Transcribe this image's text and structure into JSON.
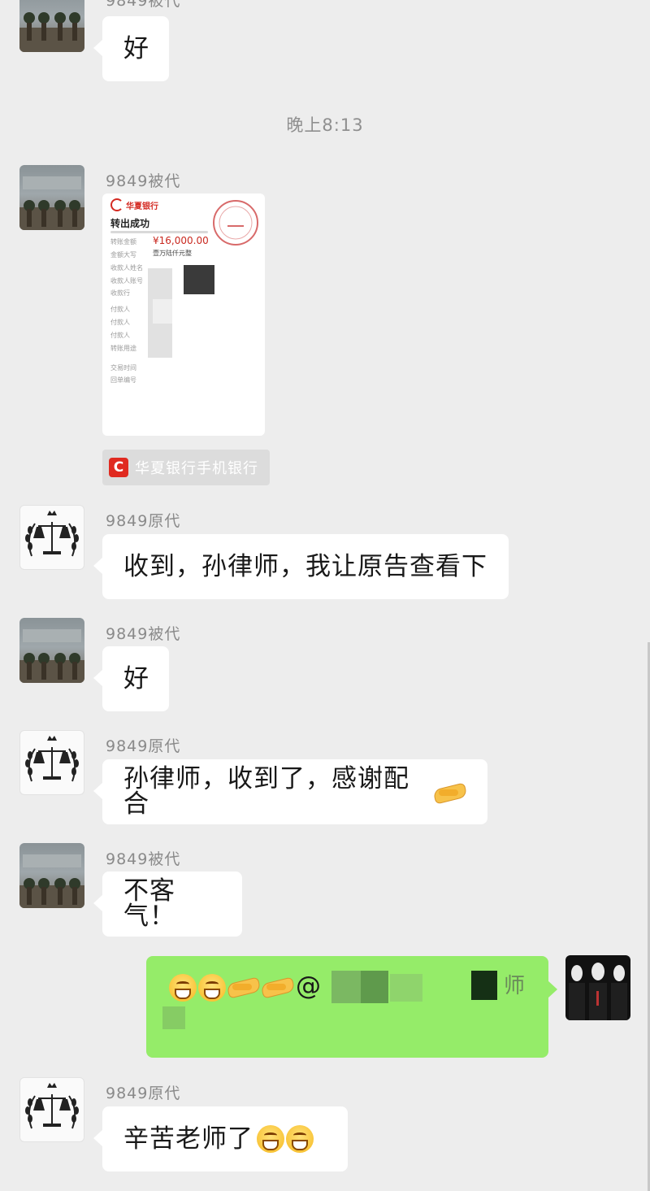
{
  "timestamp": "晚上8:13",
  "messages": [
    {
      "sender": "9849被代",
      "text": "好"
    },
    {
      "sender": "9849被代",
      "kind": "image"
    },
    {
      "sender": "9849原代",
      "text": "收到，孙律师，我让原告查看下"
    },
    {
      "sender": "9849被代",
      "text": "好"
    },
    {
      "sender": "9849原代",
      "text": "孙律师，收到了，感谢配合"
    },
    {
      "sender": "9849被代",
      "text": "不客气！"
    },
    {
      "sender": "self",
      "text": "@",
      "trail": "师"
    },
    {
      "sender": "9849原代",
      "text": "辛苦老师了"
    }
  ],
  "receipt": {
    "bank_logo": "华夏银行",
    "title": "转出成功",
    "amount_label": "转账金额",
    "amount": "¥16,000.00",
    "upper_label": "金额大写",
    "amount_upper": "壹万陆仟元整",
    "payee_name_label": "收款人姓名",
    "payee_account_label": "收款人账号",
    "payee_bank_label": "收款行",
    "payer_label": "付款人",
    "payer_account_label": "付款人",
    "payer_bank_label": "付款人",
    "purpose_label": "转账用途",
    "time_label": "交易时间",
    "note_label": "回单编号"
  },
  "link_source": "华夏银行手机银行",
  "colors": {
    "background": "#ededed",
    "self_bubble": "#95ec69",
    "bank_red": "#e02a20"
  }
}
